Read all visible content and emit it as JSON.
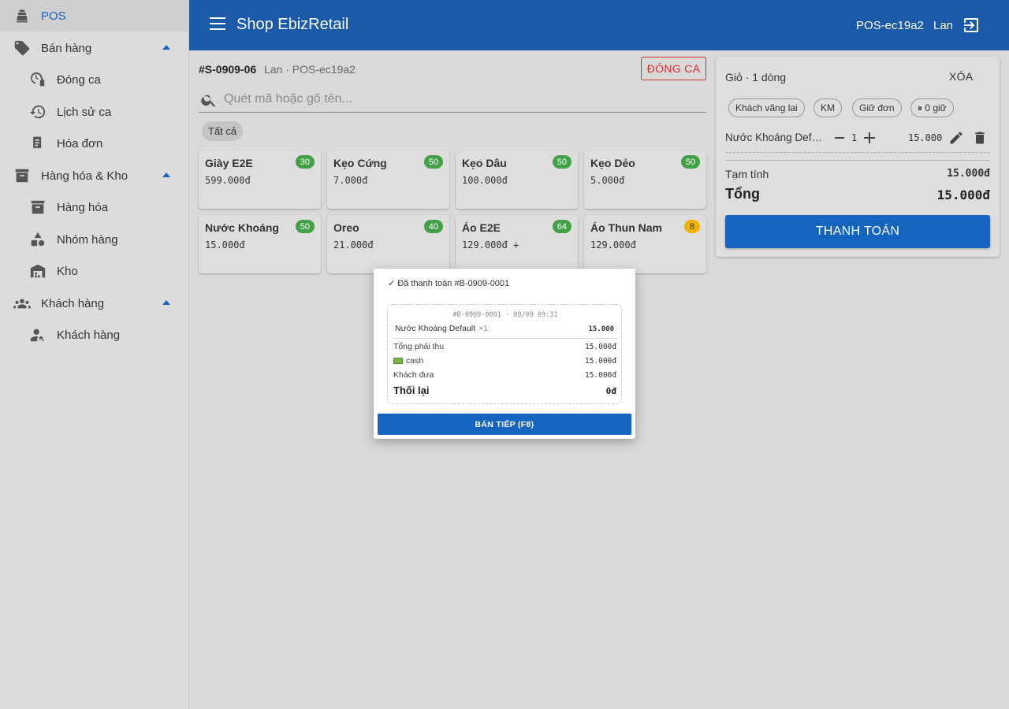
{
  "colors": {
    "primary": "#1a5aa8",
    "button": "#1565c0",
    "badge_green": "#43a047",
    "badge_yellow": "#f0b400",
    "danger": "#d32f2f"
  },
  "sidebar": {
    "items": [
      {
        "label": "POS",
        "icon": "cash-register-icon",
        "active": true
      },
      {
        "label": "Bán hàng",
        "icon": "tag-icon",
        "expanded": true
      },
      {
        "label": "Đóng ca",
        "icon": "clock-lock-icon"
      },
      {
        "label": "Lịch sử ca",
        "icon": "history-icon"
      },
      {
        "label": "Hóa đơn",
        "icon": "receipt-icon"
      },
      {
        "label": "Hàng hóa & Kho",
        "icon": "archive-icon",
        "expanded": true
      },
      {
        "label": "Hàng hóa",
        "icon": "archive-icon"
      },
      {
        "label": "Nhóm hàng",
        "icon": "shapes-icon"
      },
      {
        "label": "Kho",
        "icon": "warehouse-icon"
      },
      {
        "label": "Khách hàng",
        "icon": "people-icon",
        "expanded": true
      },
      {
        "label": "Khách hàng",
        "icon": "person-search-icon"
      }
    ]
  },
  "header": {
    "title": "Shop EbizRetail",
    "pos_id": "POS-ec19a2",
    "user": "Lan"
  },
  "sale": {
    "id": "#S-0909-06",
    "meta": "Lan · POS-ec19a2",
    "close_shift": "ĐÓNG CA",
    "search_placeholder": "Quét mã hoặc gõ tên...",
    "filter_chip": "Tất cả"
  },
  "products": [
    {
      "name": "Giày E2E",
      "price": "599.000đ",
      "stock": "30"
    },
    {
      "name": "Kẹo Cứng",
      "price": "7.000đ",
      "stock": "50"
    },
    {
      "name": "Kẹo Dâu",
      "price": "100.000đ",
      "stock": "50"
    },
    {
      "name": "Kẹo Dẻo",
      "price": "5.000đ",
      "stock": "50"
    },
    {
      "name": "Nước Khoáng",
      "price": "15.000đ",
      "stock": "50"
    },
    {
      "name": "Oreo",
      "price": "21.000đ",
      "stock": "40"
    },
    {
      "name": "Áo E2E",
      "price": "129.000đ +",
      "stock": "64"
    },
    {
      "name": "Áo Thun Nam",
      "price": "129.000đ",
      "stock": "8"
    }
  ],
  "cart": {
    "title": "Giỏ · 1 dòng",
    "clear": "XÓA",
    "chips": [
      "Khách vãng lai",
      "KM",
      "Giữ đơn",
      "⏸ 0 giữ"
    ],
    "line": {
      "name": "Nước Khoáng Default",
      "qty": "1",
      "price": "15.000"
    },
    "subtotal_label": "Tạm tính",
    "subtotal": "15.000đ",
    "total_label": "Tổng",
    "total": "15.000đ",
    "pay": "THANH TOÁN"
  },
  "modal": {
    "title": "✓ Đã thanh toán #B-0909-0001",
    "receipt_head": "#B-0909-0001 · 09/09 09:31",
    "item_name": "Nước Khoáng Default",
    "item_qty": "×1",
    "item_price": "15.000",
    "rows": [
      {
        "label": "Tổng phải thu",
        "value": "15.000đ"
      },
      {
        "label": "cash",
        "value": "15.000đ"
      },
      {
        "label": "Khách đưa",
        "value": "15.000đ"
      }
    ],
    "change_label": "Thối lại",
    "change_value": "0đ",
    "button": "BÁN TIẾP (F8)"
  }
}
